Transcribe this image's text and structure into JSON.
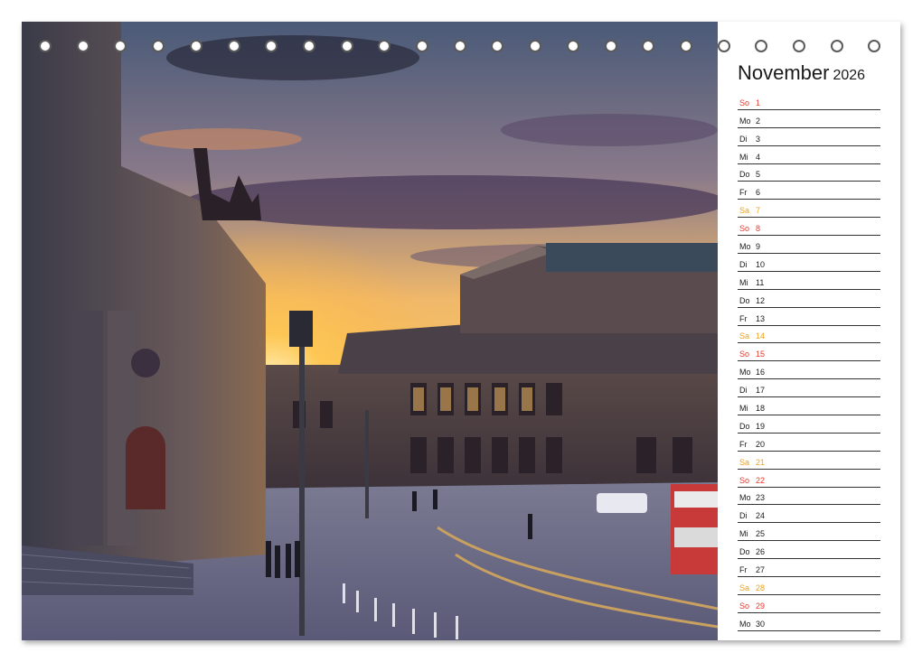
{
  "calendar": {
    "month": "November",
    "year": "2026",
    "days": [
      {
        "wd": "So",
        "n": "1",
        "type": "sun"
      },
      {
        "wd": "Mo",
        "n": "2",
        "type": "week"
      },
      {
        "wd": "Di",
        "n": "3",
        "type": "week"
      },
      {
        "wd": "Mi",
        "n": "4",
        "type": "week"
      },
      {
        "wd": "Do",
        "n": "5",
        "type": "week"
      },
      {
        "wd": "Fr",
        "n": "6",
        "type": "week"
      },
      {
        "wd": "Sa",
        "n": "7",
        "type": "sat"
      },
      {
        "wd": "So",
        "n": "8",
        "type": "sun"
      },
      {
        "wd": "Mo",
        "n": "9",
        "type": "week"
      },
      {
        "wd": "Di",
        "n": "10",
        "type": "week"
      },
      {
        "wd": "Mi",
        "n": "11",
        "type": "week"
      },
      {
        "wd": "Do",
        "n": "12",
        "type": "week"
      },
      {
        "wd": "Fr",
        "n": "13",
        "type": "week"
      },
      {
        "wd": "Sa",
        "n": "14",
        "type": "sat"
      },
      {
        "wd": "So",
        "n": "15",
        "type": "sun"
      },
      {
        "wd": "Mo",
        "n": "16",
        "type": "week"
      },
      {
        "wd": "Di",
        "n": "17",
        "type": "week"
      },
      {
        "wd": "Mi",
        "n": "18",
        "type": "week"
      },
      {
        "wd": "Do",
        "n": "19",
        "type": "week"
      },
      {
        "wd": "Fr",
        "n": "20",
        "type": "week"
      },
      {
        "wd": "Sa",
        "n": "21",
        "type": "sat"
      },
      {
        "wd": "So",
        "n": "22",
        "type": "sun"
      },
      {
        "wd": "Mo",
        "n": "23",
        "type": "week"
      },
      {
        "wd": "Di",
        "n": "24",
        "type": "week"
      },
      {
        "wd": "Mi",
        "n": "25",
        "type": "week"
      },
      {
        "wd": "Do",
        "n": "26",
        "type": "week"
      },
      {
        "wd": "Fr",
        "n": "27",
        "type": "week"
      },
      {
        "wd": "Sa",
        "n": "28",
        "type": "sat"
      },
      {
        "wd": "So",
        "n": "29",
        "type": "sun"
      },
      {
        "wd": "Mo",
        "n": "30",
        "type": "week"
      }
    ]
  },
  "colors": {
    "sunday": "#e8372a",
    "saturday": "#f0a01a",
    "weekday": "#1a1a1a",
    "ring": "#5a5a5a"
  },
  "binding": {
    "ring_count": 24
  }
}
